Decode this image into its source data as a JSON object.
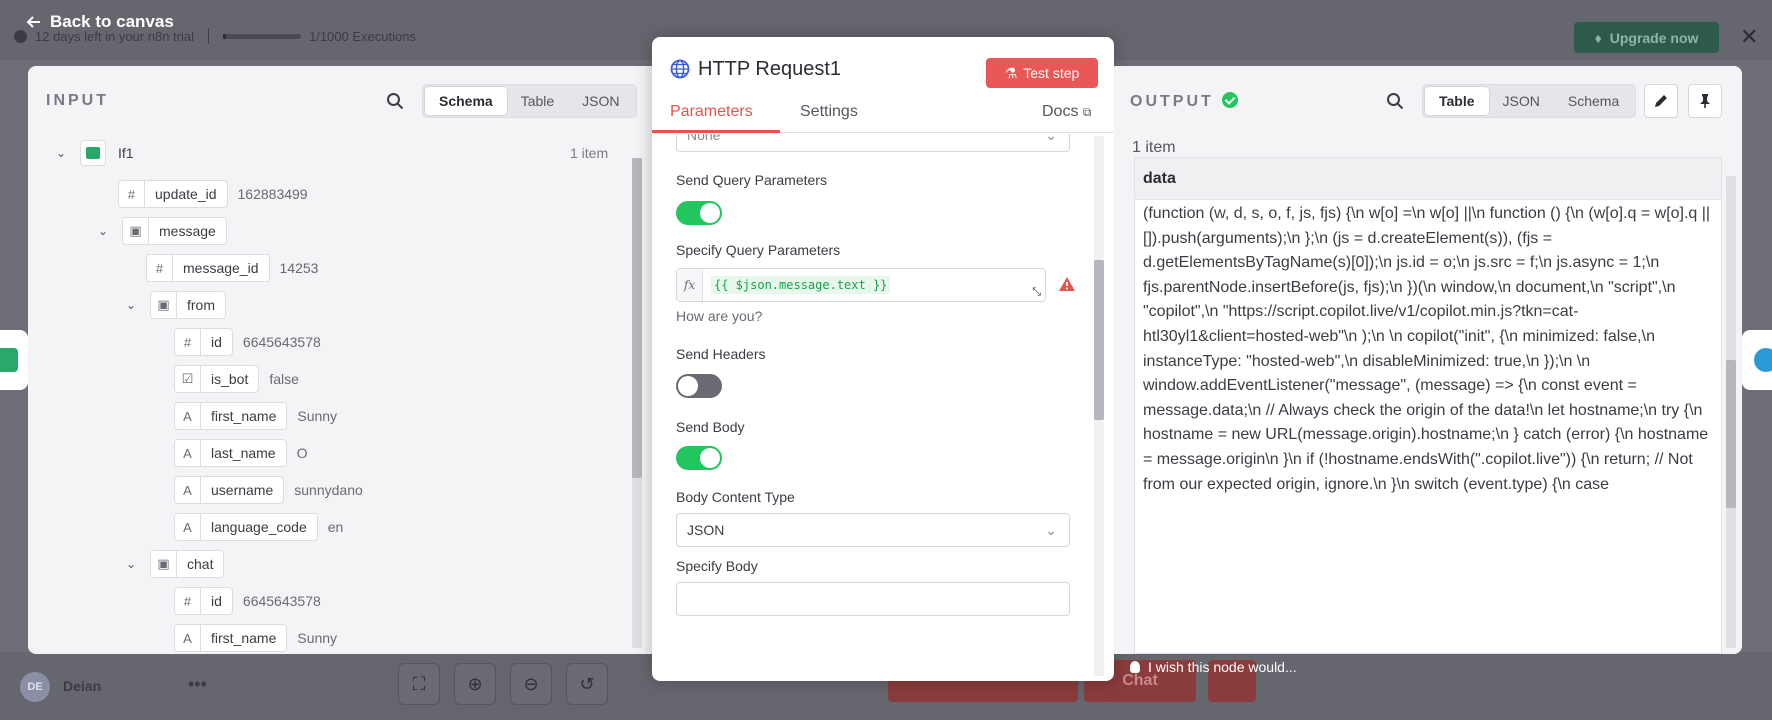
{
  "background": {
    "back_to_canvas": "Back to canvas",
    "trial_text": "12 days left in your n8n trial",
    "executions": "1/1000 Executions",
    "execution_usage_fraction": 0.001,
    "upgrade": "Upgrade now",
    "user_initials": "DE",
    "user_name": "Deian",
    "bg_button_chat": "Chat"
  },
  "input": {
    "title": "INPUT",
    "tabs": [
      "Schema",
      "Table",
      "JSON"
    ],
    "active_tab": "Schema",
    "node_name": "If1",
    "item_count": "1 item",
    "fields": {
      "update_id": {
        "key": "update_id",
        "type": "#",
        "value": "162883499"
      },
      "message": {
        "key": "message"
      },
      "message_id": {
        "key": "message_id",
        "type": "#",
        "value": "14253"
      },
      "from": {
        "key": "from"
      },
      "from_id": {
        "key": "id",
        "type": "#",
        "value": "6645643578"
      },
      "is_bot": {
        "key": "is_bot",
        "value": "false"
      },
      "first_name": {
        "key": "first_name",
        "type": "A",
        "value": "Sunny"
      },
      "last_name": {
        "key": "last_name",
        "type": "A",
        "value": "O"
      },
      "username": {
        "key": "username",
        "type": "A",
        "value": "sunnydano"
      },
      "language_code": {
        "key": "language_code",
        "type": "A",
        "value": "en"
      },
      "chat": {
        "key": "chat"
      },
      "chat_id": {
        "key": "id",
        "type": "#",
        "value": "6645643578"
      },
      "chat_first_name": {
        "key": "first_name",
        "type": "A",
        "value": "Sunny"
      }
    }
  },
  "node": {
    "title": "HTTP Request1",
    "test_step": "Test step",
    "tab_parameters": "Parameters",
    "tab_settings": "Settings",
    "docs": "Docs",
    "top_select_value": "None",
    "send_query_label": "Send Query Parameters",
    "specify_query_label": "Specify Query Parameters",
    "specify_query_value": "{{ $json.message.text }}",
    "query_preview": "How are you?",
    "send_headers_label": "Send Headers",
    "send_body_label": "Send Body",
    "body_content_type_label": "Body Content Type",
    "body_content_type_value": "JSON",
    "specify_body_label": "Specify Body",
    "send_query_on": true,
    "send_headers_on": false,
    "send_body_on": true
  },
  "output": {
    "title": "OUTPUT",
    "tabs": [
      "Table",
      "JSON",
      "Schema"
    ],
    "active_tab": "Table",
    "item_count": "1 item",
    "column": "data",
    "text": "(function (w, d, s, o, f, js, fjs) {\\n         w[o] =\\n          w[o] ||\\n function () {\\n          (w[o].q = w[o].q || []).push(arguments);\\n };\\n         (js = d.createElement(s)), (fjs = d.getElementsByTagName(s)[0]);\\n         js.id = o;\\n          js.src = f;\\n          js.async = 1;\\n fjs.parentNode.insertBefore(js, fjs);\\n        })(\\n        window,\\n document,\\n         \"script\",\\n         \"copilot\",\\n \"https://script.copilot.live/v1/copilot.min.js?tkn=cat-htl30yl1&client=hosted-web\"\\n        );\\n \\n       copilot(\"init\", {\\n minimized: false,\\n         instanceType: \"hosted-web\",\\n disableMinimized: true,\\n         });\\n \\n window.addEventListener(\"message\", (message) => {\\n         const event = message.data;\\n         // Always check the origin of the data!\\n         let hostname;\\n         try {\\n           hostname = new URL(message.origin).hostname;\\n          } catch (error) {\\n hostname = message.origin\\n          }\\n          if (!hostname.endsWith(\".copilot.live\")) {\\n           return; // Not from our expected origin, ignore.\\n          }\\n         switch (event.type) {\\n          case"
  },
  "feedback": "I wish this node would..."
}
